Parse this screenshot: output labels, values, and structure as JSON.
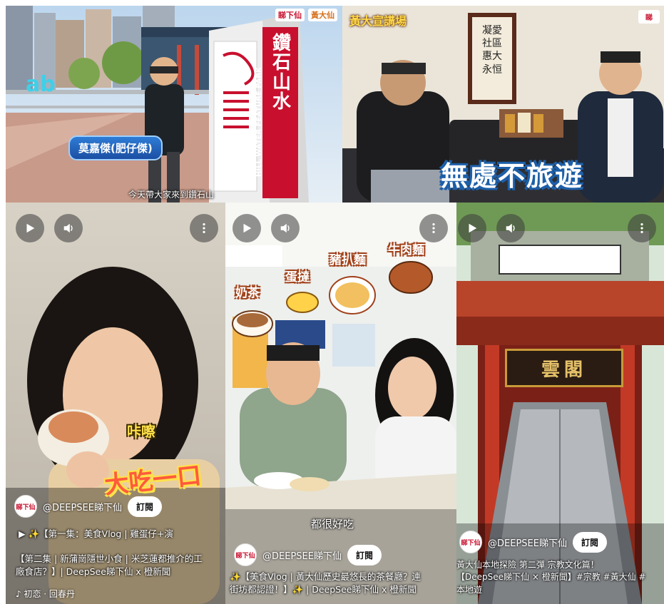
{
  "top_left": {
    "name_tag": "莫嘉傑(肥仔傑)",
    "subtitle": "今天帶大家來到鑽石山",
    "brand_1": "睇下仙",
    "brand_2": "黃大仙",
    "sign_text_cn": "鑽石山水",
    "sign_text_en": "HILL WATER FEATURE PARK"
  },
  "top_right": {
    "show_title": "黃大宣講場",
    "caption": "無處不旅遊",
    "logo": "睇",
    "calligraphy": "凝愛社區 惠大永恒"
  },
  "colors": {
    "brand_red": "#c8102e",
    "caption_blue": "#1d5fa8",
    "gold": "#ffd84a"
  },
  "videos": [
    {
      "channel_avatar": "睇下仙",
      "channel": "@DEEPSEE睇下仙",
      "subscribe": "訂閱",
      "sticker_small": "咔嚓",
      "sticker_big": "大吃一口",
      "playlist_line": "【第一集：美食Vlog | 雞蛋仔+演",
      "title_line1": "【第二集 | 新蒲崗隱世小食 | 米芝蓮都推介的工",
      "title_line2": "廠食店？】| DeepSee睇下仙 x 橙新聞",
      "music": "初恋 · 回春丹"
    },
    {
      "channel_avatar": "睇下仙",
      "channel": "@DEEPSEE睇下仙",
      "subscribe": "訂閱",
      "food_labels": [
        "奶茶",
        "蛋撻",
        "豬扒麵",
        "牛肉麵"
      ],
      "mid_caption": "都很好吃",
      "title_line1": "✨【美食Vlog | 黃大仙歷史最悠長的茶餐廳？連",
      "title_line2": "街坊都認證！】✨ | DeepSee睇下仙 x 橙新聞"
    },
    {
      "channel_avatar": "睇下仙",
      "channel": "@DEEPSEE睇下仙",
      "subscribe": "訂閱",
      "plaque": "雲閣",
      "title_line1": "黃大仙本地探險 第二彈 宗教文化篇！",
      "title_line2": "【DeepSee睇下仙 × 橙新聞】#宗教 #黃大仙 #",
      "title_line3": "本地遊"
    }
  ]
}
